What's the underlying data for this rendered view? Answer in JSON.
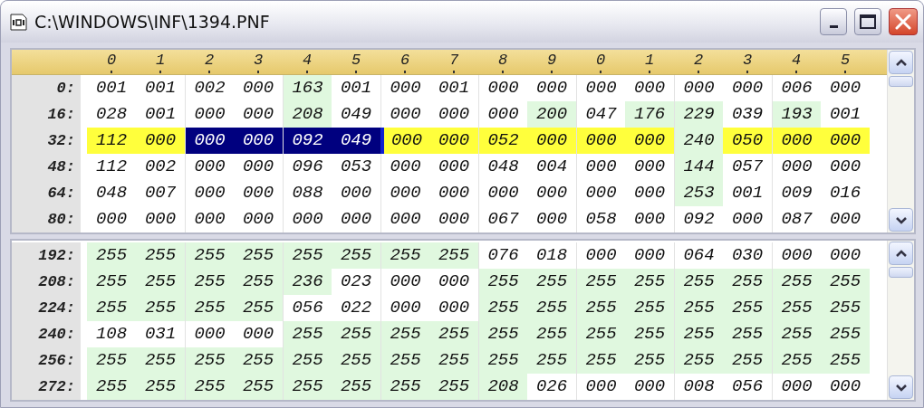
{
  "window": {
    "title": "C:\\WINDOWS\\INF\\1394.PNF"
  },
  "panes": [
    {
      "header": [
        "0",
        "1",
        "2",
        "3",
        "4",
        "5",
        "6",
        "7",
        "8",
        "9",
        "0",
        "1",
        "2",
        "3",
        "4",
        "5"
      ],
      "rows": [
        {
          "offset": "0:",
          "selected": false,
          "cells": [
            {
              "value": "001",
              "shaded": false,
              "selected": false,
              "cursor": false
            },
            {
              "value": "001",
              "shaded": false,
              "selected": false,
              "cursor": false
            },
            {
              "value": "002",
              "shaded": false,
              "selected": false,
              "cursor": false
            },
            {
              "value": "000",
              "shaded": false,
              "selected": false,
              "cursor": false
            },
            {
              "value": "163",
              "shaded": true,
              "selected": false,
              "cursor": false
            },
            {
              "value": "001",
              "shaded": false,
              "selected": false,
              "cursor": false
            },
            {
              "value": "000",
              "shaded": false,
              "selected": false,
              "cursor": false
            },
            {
              "value": "001",
              "shaded": false,
              "selected": false,
              "cursor": false
            },
            {
              "value": "000",
              "shaded": false,
              "selected": false,
              "cursor": false
            },
            {
              "value": "000",
              "shaded": false,
              "selected": false,
              "cursor": false
            },
            {
              "value": "000",
              "shaded": false,
              "selected": false,
              "cursor": false
            },
            {
              "value": "000",
              "shaded": false,
              "selected": false,
              "cursor": false
            },
            {
              "value": "000",
              "shaded": false,
              "selected": false,
              "cursor": false
            },
            {
              "value": "000",
              "shaded": false,
              "selected": false,
              "cursor": false
            },
            {
              "value": "006",
              "shaded": false,
              "selected": false,
              "cursor": false
            },
            {
              "value": "000",
              "shaded": false,
              "selected": false,
              "cursor": false
            }
          ]
        },
        {
          "offset": "16:",
          "selected": false,
          "cells": [
            {
              "value": "028",
              "shaded": false,
              "selected": false,
              "cursor": false
            },
            {
              "value": "001",
              "shaded": false,
              "selected": false,
              "cursor": false
            },
            {
              "value": "000",
              "shaded": false,
              "selected": false,
              "cursor": false
            },
            {
              "value": "000",
              "shaded": false,
              "selected": false,
              "cursor": false
            },
            {
              "value": "208",
              "shaded": true,
              "selected": false,
              "cursor": false
            },
            {
              "value": "049",
              "shaded": false,
              "selected": false,
              "cursor": false
            },
            {
              "value": "000",
              "shaded": false,
              "selected": false,
              "cursor": false
            },
            {
              "value": "000",
              "shaded": false,
              "selected": false,
              "cursor": false
            },
            {
              "value": "000",
              "shaded": false,
              "selected": false,
              "cursor": false
            },
            {
              "value": "200",
              "shaded": true,
              "selected": false,
              "cursor": false
            },
            {
              "value": "047",
              "shaded": false,
              "selected": false,
              "cursor": false
            },
            {
              "value": "176",
              "shaded": true,
              "selected": false,
              "cursor": false
            },
            {
              "value": "229",
              "shaded": true,
              "selected": false,
              "cursor": false
            },
            {
              "value": "039",
              "shaded": false,
              "selected": false,
              "cursor": false
            },
            {
              "value": "193",
              "shaded": true,
              "selected": false,
              "cursor": false
            },
            {
              "value": "001",
              "shaded": false,
              "selected": false,
              "cursor": false
            }
          ]
        },
        {
          "offset": "32:",
          "selected": true,
          "cells": [
            {
              "value": "112",
              "shaded": false,
              "selected": false,
              "cursor": false
            },
            {
              "value": "000",
              "shaded": false,
              "selected": false,
              "cursor": false
            },
            {
              "value": "000",
              "shaded": false,
              "selected": true,
              "cursor": false
            },
            {
              "value": "000",
              "shaded": false,
              "selected": true,
              "cursor": false
            },
            {
              "value": "092",
              "shaded": false,
              "selected": true,
              "cursor": false
            },
            {
              "value": "049",
              "shaded": false,
              "selected": true,
              "cursor": false
            },
            {
              "value": "000",
              "shaded": false,
              "selected": false,
              "cursor": true
            },
            {
              "value": "000",
              "shaded": false,
              "selected": false,
              "cursor": false
            },
            {
              "value": "052",
              "shaded": false,
              "selected": false,
              "cursor": false
            },
            {
              "value": "000",
              "shaded": false,
              "selected": false,
              "cursor": false
            },
            {
              "value": "000",
              "shaded": false,
              "selected": false,
              "cursor": false
            },
            {
              "value": "000",
              "shaded": false,
              "selected": false,
              "cursor": false
            },
            {
              "value": "240",
              "shaded": true,
              "selected": false,
              "cursor": false
            },
            {
              "value": "050",
              "shaded": false,
              "selected": false,
              "cursor": false
            },
            {
              "value": "000",
              "shaded": false,
              "selected": false,
              "cursor": false
            },
            {
              "value": "000",
              "shaded": false,
              "selected": false,
              "cursor": false
            }
          ]
        },
        {
          "offset": "48:",
          "selected": false,
          "cells": [
            {
              "value": "112",
              "shaded": false,
              "selected": false,
              "cursor": false
            },
            {
              "value": "002",
              "shaded": false,
              "selected": false,
              "cursor": false
            },
            {
              "value": "000",
              "shaded": false,
              "selected": false,
              "cursor": false
            },
            {
              "value": "000",
              "shaded": false,
              "selected": false,
              "cursor": false
            },
            {
              "value": "096",
              "shaded": false,
              "selected": false,
              "cursor": false
            },
            {
              "value": "053",
              "shaded": false,
              "selected": false,
              "cursor": false
            },
            {
              "value": "000",
              "shaded": false,
              "selected": false,
              "cursor": false
            },
            {
              "value": "000",
              "shaded": false,
              "selected": false,
              "cursor": false
            },
            {
              "value": "048",
              "shaded": false,
              "selected": false,
              "cursor": false
            },
            {
              "value": "004",
              "shaded": false,
              "selected": false,
              "cursor": false
            },
            {
              "value": "000",
              "shaded": false,
              "selected": false,
              "cursor": false
            },
            {
              "value": "000",
              "shaded": false,
              "selected": false,
              "cursor": false
            },
            {
              "value": "144",
              "shaded": true,
              "selected": false,
              "cursor": false
            },
            {
              "value": "057",
              "shaded": false,
              "selected": false,
              "cursor": false
            },
            {
              "value": "000",
              "shaded": false,
              "selected": false,
              "cursor": false
            },
            {
              "value": "000",
              "shaded": false,
              "selected": false,
              "cursor": false
            }
          ]
        },
        {
          "offset": "64:",
          "selected": false,
          "cells": [
            {
              "value": "048",
              "shaded": false,
              "selected": false,
              "cursor": false
            },
            {
              "value": "007",
              "shaded": false,
              "selected": false,
              "cursor": false
            },
            {
              "value": "000",
              "shaded": false,
              "selected": false,
              "cursor": false
            },
            {
              "value": "000",
              "shaded": false,
              "selected": false,
              "cursor": false
            },
            {
              "value": "088",
              "shaded": false,
              "selected": false,
              "cursor": false
            },
            {
              "value": "000",
              "shaded": false,
              "selected": false,
              "cursor": false
            },
            {
              "value": "000",
              "shaded": false,
              "selected": false,
              "cursor": false
            },
            {
              "value": "000",
              "shaded": false,
              "selected": false,
              "cursor": false
            },
            {
              "value": "000",
              "shaded": false,
              "selected": false,
              "cursor": false
            },
            {
              "value": "000",
              "shaded": false,
              "selected": false,
              "cursor": false
            },
            {
              "value": "000",
              "shaded": false,
              "selected": false,
              "cursor": false
            },
            {
              "value": "000",
              "shaded": false,
              "selected": false,
              "cursor": false
            },
            {
              "value": "253",
              "shaded": true,
              "selected": false,
              "cursor": false
            },
            {
              "value": "001",
              "shaded": false,
              "selected": false,
              "cursor": false
            },
            {
              "value": "009",
              "shaded": false,
              "selected": false,
              "cursor": false
            },
            {
              "value": "016",
              "shaded": false,
              "selected": false,
              "cursor": false
            }
          ]
        },
        {
          "offset": "80:",
          "selected": false,
          "cells": [
            {
              "value": "000",
              "shaded": false,
              "selected": false,
              "cursor": false
            },
            {
              "value": "000",
              "shaded": false,
              "selected": false,
              "cursor": false
            },
            {
              "value": "000",
              "shaded": false,
              "selected": false,
              "cursor": false
            },
            {
              "value": "000",
              "shaded": false,
              "selected": false,
              "cursor": false
            },
            {
              "value": "000",
              "shaded": false,
              "selected": false,
              "cursor": false
            },
            {
              "value": "000",
              "shaded": false,
              "selected": false,
              "cursor": false
            },
            {
              "value": "000",
              "shaded": false,
              "selected": false,
              "cursor": false
            },
            {
              "value": "000",
              "shaded": false,
              "selected": false,
              "cursor": false
            },
            {
              "value": "067",
              "shaded": false,
              "selected": false,
              "cursor": false
            },
            {
              "value": "000",
              "shaded": false,
              "selected": false,
              "cursor": false
            },
            {
              "value": "058",
              "shaded": false,
              "selected": false,
              "cursor": false
            },
            {
              "value": "000",
              "shaded": false,
              "selected": false,
              "cursor": false
            },
            {
              "value": "092",
              "shaded": false,
              "selected": false,
              "cursor": false
            },
            {
              "value": "000",
              "shaded": false,
              "selected": false,
              "cursor": false
            },
            {
              "value": "087",
              "shaded": false,
              "selected": false,
              "cursor": false
            },
            {
              "value": "000",
              "shaded": false,
              "selected": false,
              "cursor": false
            }
          ]
        }
      ]
    },
    {
      "rows": [
        {
          "offset": "192:",
          "cells": [
            {
              "value": "255",
              "shaded": true,
              "selected": false,
              "cursor": false
            },
            {
              "value": "255",
              "shaded": true,
              "selected": false,
              "cursor": false
            },
            {
              "value": "255",
              "shaded": true,
              "selected": false,
              "cursor": false
            },
            {
              "value": "255",
              "shaded": true,
              "selected": false,
              "cursor": false
            },
            {
              "value": "255",
              "shaded": true,
              "selected": false,
              "cursor": false
            },
            {
              "value": "255",
              "shaded": true,
              "selected": false,
              "cursor": false
            },
            {
              "value": "255",
              "shaded": true,
              "selected": false,
              "cursor": false
            },
            {
              "value": "255",
              "shaded": true,
              "selected": false,
              "cursor": false
            },
            {
              "value": "076",
              "shaded": false,
              "selected": false,
              "cursor": false
            },
            {
              "value": "018",
              "shaded": false,
              "selected": false,
              "cursor": false
            },
            {
              "value": "000",
              "shaded": false,
              "selected": false,
              "cursor": false
            },
            {
              "value": "000",
              "shaded": false,
              "selected": false,
              "cursor": false
            },
            {
              "value": "064",
              "shaded": false,
              "selected": false,
              "cursor": false
            },
            {
              "value": "030",
              "shaded": false,
              "selected": false,
              "cursor": false
            },
            {
              "value": "000",
              "shaded": false,
              "selected": false,
              "cursor": false
            },
            {
              "value": "000",
              "shaded": false,
              "selected": false,
              "cursor": false
            }
          ]
        },
        {
          "offset": "208:",
          "cells": [
            {
              "value": "255",
              "shaded": true,
              "selected": false,
              "cursor": false
            },
            {
              "value": "255",
              "shaded": true,
              "selected": false,
              "cursor": false
            },
            {
              "value": "255",
              "shaded": true,
              "selected": false,
              "cursor": false
            },
            {
              "value": "255",
              "shaded": true,
              "selected": false,
              "cursor": false
            },
            {
              "value": "236",
              "shaded": true,
              "selected": false,
              "cursor": false
            },
            {
              "value": "023",
              "shaded": false,
              "selected": false,
              "cursor": false
            },
            {
              "value": "000",
              "shaded": false,
              "selected": false,
              "cursor": false
            },
            {
              "value": "000",
              "shaded": false,
              "selected": false,
              "cursor": false
            },
            {
              "value": "255",
              "shaded": true,
              "selected": false,
              "cursor": false
            },
            {
              "value": "255",
              "shaded": true,
              "selected": false,
              "cursor": false
            },
            {
              "value": "255",
              "shaded": true,
              "selected": false,
              "cursor": false
            },
            {
              "value": "255",
              "shaded": true,
              "selected": false,
              "cursor": false
            },
            {
              "value": "255",
              "shaded": true,
              "selected": false,
              "cursor": false
            },
            {
              "value": "255",
              "shaded": true,
              "selected": false,
              "cursor": false
            },
            {
              "value": "255",
              "shaded": true,
              "selected": false,
              "cursor": false
            },
            {
              "value": "255",
              "shaded": true,
              "selected": false,
              "cursor": false
            }
          ]
        },
        {
          "offset": "224:",
          "cells": [
            {
              "value": "255",
              "shaded": true,
              "selected": false,
              "cursor": false
            },
            {
              "value": "255",
              "shaded": true,
              "selected": false,
              "cursor": false
            },
            {
              "value": "255",
              "shaded": true,
              "selected": false,
              "cursor": false
            },
            {
              "value": "255",
              "shaded": true,
              "selected": false,
              "cursor": false
            },
            {
              "value": "056",
              "shaded": false,
              "selected": false,
              "cursor": false
            },
            {
              "value": "022",
              "shaded": false,
              "selected": false,
              "cursor": false
            },
            {
              "value": "000",
              "shaded": false,
              "selected": false,
              "cursor": false
            },
            {
              "value": "000",
              "shaded": false,
              "selected": false,
              "cursor": false
            },
            {
              "value": "255",
              "shaded": true,
              "selected": false,
              "cursor": false
            },
            {
              "value": "255",
              "shaded": true,
              "selected": false,
              "cursor": false
            },
            {
              "value": "255",
              "shaded": true,
              "selected": false,
              "cursor": false
            },
            {
              "value": "255",
              "shaded": true,
              "selected": false,
              "cursor": false
            },
            {
              "value": "255",
              "shaded": true,
              "selected": false,
              "cursor": false
            },
            {
              "value": "255",
              "shaded": true,
              "selected": false,
              "cursor": false
            },
            {
              "value": "255",
              "shaded": true,
              "selected": false,
              "cursor": false
            },
            {
              "value": "255",
              "shaded": true,
              "selected": false,
              "cursor": false
            }
          ]
        },
        {
          "offset": "240:",
          "cells": [
            {
              "value": "108",
              "shaded": false,
              "selected": false,
              "cursor": false
            },
            {
              "value": "031",
              "shaded": false,
              "selected": false,
              "cursor": false
            },
            {
              "value": "000",
              "shaded": false,
              "selected": false,
              "cursor": false
            },
            {
              "value": "000",
              "shaded": false,
              "selected": false,
              "cursor": false
            },
            {
              "value": "255",
              "shaded": true,
              "selected": false,
              "cursor": false
            },
            {
              "value": "255",
              "shaded": true,
              "selected": false,
              "cursor": false
            },
            {
              "value": "255",
              "shaded": true,
              "selected": false,
              "cursor": false
            },
            {
              "value": "255",
              "shaded": true,
              "selected": false,
              "cursor": false
            },
            {
              "value": "255",
              "shaded": true,
              "selected": false,
              "cursor": false
            },
            {
              "value": "255",
              "shaded": true,
              "selected": false,
              "cursor": false
            },
            {
              "value": "255",
              "shaded": true,
              "selected": false,
              "cursor": false
            },
            {
              "value": "255",
              "shaded": true,
              "selected": false,
              "cursor": false
            },
            {
              "value": "255",
              "shaded": true,
              "selected": false,
              "cursor": false
            },
            {
              "value": "255",
              "shaded": true,
              "selected": false,
              "cursor": false
            },
            {
              "value": "255",
              "shaded": true,
              "selected": false,
              "cursor": false
            },
            {
              "value": "255",
              "shaded": true,
              "selected": false,
              "cursor": false
            }
          ]
        },
        {
          "offset": "256:",
          "cells": [
            {
              "value": "255",
              "shaded": true,
              "selected": false,
              "cursor": false
            },
            {
              "value": "255",
              "shaded": true,
              "selected": false,
              "cursor": false
            },
            {
              "value": "255",
              "shaded": true,
              "selected": false,
              "cursor": false
            },
            {
              "value": "255",
              "shaded": true,
              "selected": false,
              "cursor": false
            },
            {
              "value": "255",
              "shaded": true,
              "selected": false,
              "cursor": false
            },
            {
              "value": "255",
              "shaded": true,
              "selected": false,
              "cursor": false
            },
            {
              "value": "255",
              "shaded": true,
              "selected": false,
              "cursor": false
            },
            {
              "value": "255",
              "shaded": true,
              "selected": false,
              "cursor": false
            },
            {
              "value": "255",
              "shaded": true,
              "selected": false,
              "cursor": false
            },
            {
              "value": "255",
              "shaded": true,
              "selected": false,
              "cursor": false
            },
            {
              "value": "255",
              "shaded": true,
              "selected": false,
              "cursor": false
            },
            {
              "value": "255",
              "shaded": true,
              "selected": false,
              "cursor": false
            },
            {
              "value": "255",
              "shaded": true,
              "selected": false,
              "cursor": false
            },
            {
              "value": "255",
              "shaded": true,
              "selected": false,
              "cursor": false
            },
            {
              "value": "255",
              "shaded": true,
              "selected": false,
              "cursor": false
            },
            {
              "value": "255",
              "shaded": true,
              "selected": false,
              "cursor": false
            }
          ]
        },
        {
          "offset": "272:",
          "cells": [
            {
              "value": "255",
              "shaded": true,
              "selected": false,
              "cursor": false
            },
            {
              "value": "255",
              "shaded": true,
              "selected": false,
              "cursor": false
            },
            {
              "value": "255",
              "shaded": true,
              "selected": false,
              "cursor": false
            },
            {
              "value": "255",
              "shaded": true,
              "selected": false,
              "cursor": false
            },
            {
              "value": "255",
              "shaded": true,
              "selected": false,
              "cursor": false
            },
            {
              "value": "255",
              "shaded": true,
              "selected": false,
              "cursor": false
            },
            {
              "value": "255",
              "shaded": true,
              "selected": false,
              "cursor": false
            },
            {
              "value": "255",
              "shaded": true,
              "selected": false,
              "cursor": false
            },
            {
              "value": "208",
              "shaded": true,
              "selected": false,
              "cursor": false
            },
            {
              "value": "026",
              "shaded": false,
              "selected": false,
              "cursor": false
            },
            {
              "value": "000",
              "shaded": false,
              "selected": false,
              "cursor": false
            },
            {
              "value": "000",
              "shaded": false,
              "selected": false,
              "cursor": false
            },
            {
              "value": "008",
              "shaded": false,
              "selected": false,
              "cursor": false
            },
            {
              "value": "056",
              "shaded": false,
              "selected": false,
              "cursor": false
            },
            {
              "value": "000",
              "shaded": false,
              "selected": false,
              "cursor": false
            },
            {
              "value": "000",
              "shaded": false,
              "selected": false,
              "cursor": false
            }
          ]
        }
      ]
    }
  ]
}
